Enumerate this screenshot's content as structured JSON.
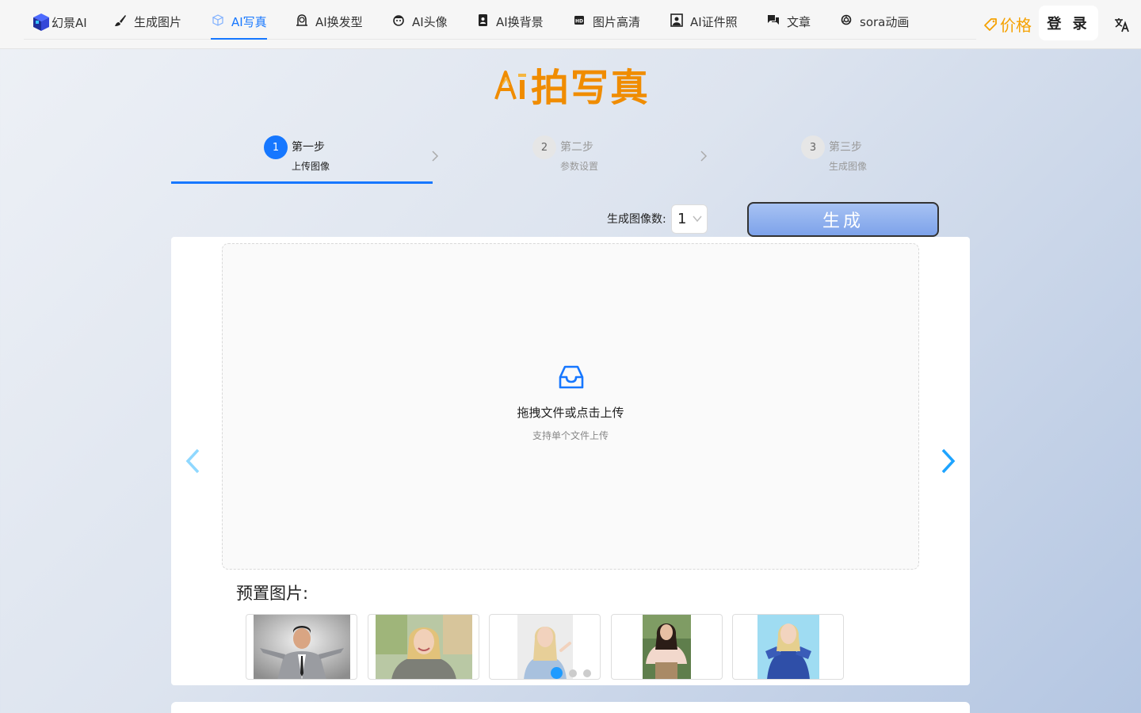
{
  "header": {
    "logo_text": "幻景AI",
    "nav": [
      {
        "label": "生成图片",
        "icon": "brush-icon"
      },
      {
        "label": "AI写真",
        "icon": "cube-icon",
        "active": true
      },
      {
        "label": "AI换发型",
        "icon": "hair-icon"
      },
      {
        "label": "AI头像",
        "icon": "face-icon"
      },
      {
        "label": "AI换背景",
        "icon": "portrait-icon"
      },
      {
        "label": "图片高清",
        "icon": "hd-icon"
      },
      {
        "label": "AI证件照",
        "icon": "id-photo-icon"
      },
      {
        "label": "文章",
        "icon": "chat-icon"
      },
      {
        "label": "sora动画",
        "icon": "openai-icon"
      }
    ],
    "price_label": "价格",
    "login_label": "登 录",
    "language_icon": "translate-icon"
  },
  "title": "拍写真",
  "steps": [
    {
      "num": "1",
      "title": "第一步",
      "desc": "上传图像",
      "active": true
    },
    {
      "num": "2",
      "title": "第二步",
      "desc": "参数设置",
      "active": false
    },
    {
      "num": "3",
      "title": "第三步",
      "desc": "生成图像",
      "active": false
    }
  ],
  "generation": {
    "count_label": "生成图像数:",
    "count_value": "1",
    "generate_label": "生成"
  },
  "upload": {
    "text": "拖拽文件或点击上传",
    "hint": "支持单个文件上传"
  },
  "presets": {
    "title": "预置图片:",
    "carousel_page": 1,
    "carousel_pages": 3
  },
  "colors": {
    "accent": "#1677ff",
    "brand_orange": "#f08c00",
    "price_orange": "#f5a100"
  }
}
